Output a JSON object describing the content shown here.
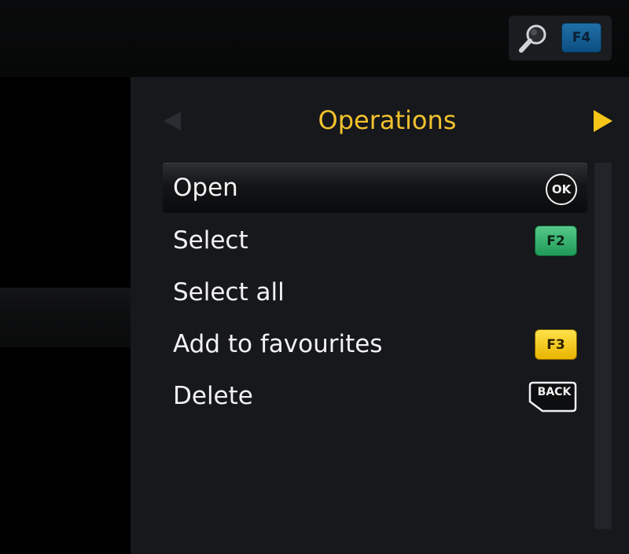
{
  "header": {
    "search_key_label": "F4"
  },
  "panel": {
    "title": "Operations"
  },
  "menu": {
    "items": [
      {
        "label": "Open",
        "key": "OK",
        "key_type": "ok",
        "selected": true
      },
      {
        "label": "Select",
        "key": "F2",
        "key_type": "green"
      },
      {
        "label": "Select all",
        "key": "",
        "key_type": "none"
      },
      {
        "label": "Add to favourites",
        "key": "F3",
        "key_type": "yellow"
      },
      {
        "label": "Delete",
        "key": "BACK",
        "key_type": "back"
      }
    ]
  },
  "icons": {
    "search": "magnifier-icon",
    "prev": "triangle-left-icon",
    "next": "triangle-right-icon"
  },
  "colors": {
    "title": "#f2c12e",
    "accent_arrow": "#f5c518",
    "green_key": "#1f9a57",
    "yellow_key": "#f0c000",
    "blue_key": "#1f6fa7"
  }
}
